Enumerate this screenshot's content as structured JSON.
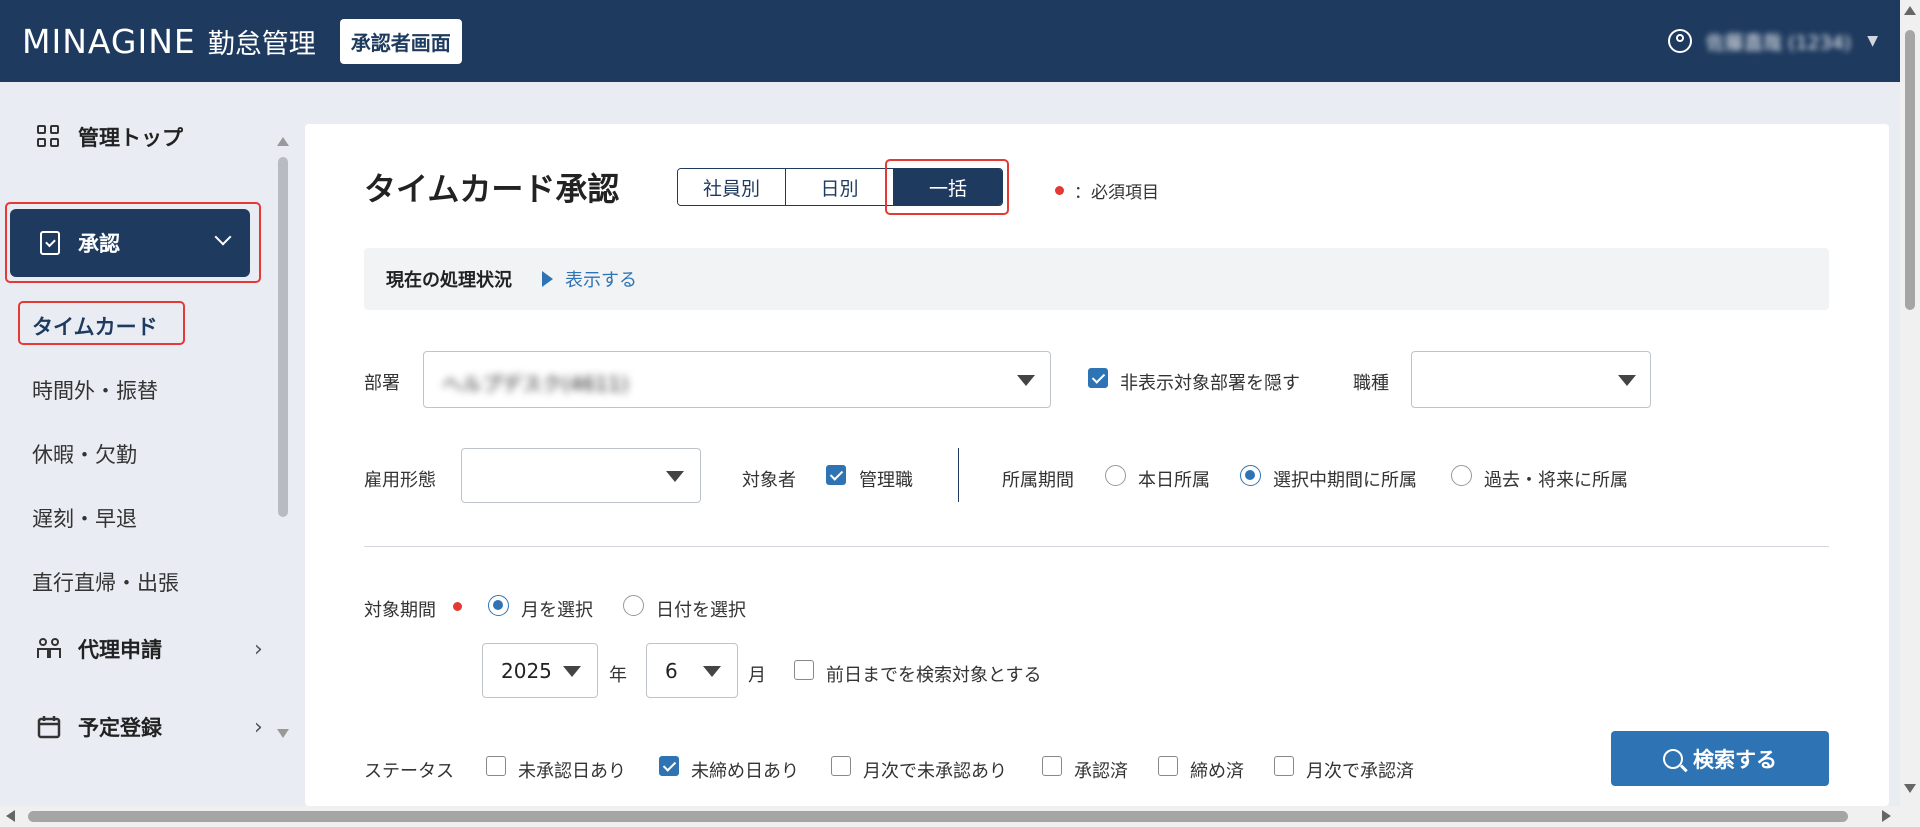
{
  "header": {
    "logo": "MINAGINE",
    "app_name": "勤怠管理",
    "role_badge": "承認者画面",
    "user_name": "佐藤直哉 (1234)"
  },
  "sidebar": {
    "items": [
      {
        "label": "管理トップ",
        "icon": "grid-icon"
      },
      {
        "label": "承認",
        "icon": "document-check-icon",
        "active": true,
        "expanded": true
      },
      {
        "label": "代理申請",
        "icon": "people-icon"
      },
      {
        "label": "予定登録",
        "icon": "calendar-icon"
      }
    ],
    "sub_items": [
      {
        "label": "タイムカード",
        "active": true
      },
      {
        "label": "時間外・振替"
      },
      {
        "label": "休暇・欠勤"
      },
      {
        "label": "遅刻・早退"
      },
      {
        "label": "直行直帰・出張"
      }
    ]
  },
  "main": {
    "title": "タイムカード承認",
    "view_tabs": [
      "社員別",
      "日別",
      "一括"
    ],
    "active_tab": "一括",
    "required_note": "：必須項目",
    "status_bar": {
      "label": "現在の処理状況",
      "toggle": "表示する"
    },
    "filters": {
      "department_label": "部署",
      "department_value": "ヘルプデスク(4611)",
      "hide_department_label": "非表示対象部署を隠す",
      "hide_department_checked": true,
      "job_label": "職種",
      "job_value": "",
      "employment_label": "雇用形態",
      "employment_value": "",
      "target_label": "対象者",
      "manager_label": "管理職",
      "manager_checked": true,
      "affiliation_label": "所属期間",
      "affiliation_options": [
        "本日所属",
        "選択中期間に所属",
        "過去・将来に所属"
      ],
      "affiliation_selected": "選択中期間に所属"
    },
    "period": {
      "label": "対象期間",
      "options": [
        "月を選択",
        "日付を選択"
      ],
      "selected": "月を選択",
      "year": "2025",
      "year_unit": "年",
      "month": "6",
      "month_unit": "月",
      "until_yesterday_label": "前日までを検索対象とする",
      "until_yesterday_checked": false
    },
    "status": {
      "label": "ステータス",
      "options": [
        {
          "label": "未承認日あり",
          "checked": false
        },
        {
          "label": "未締め日あり",
          "checked": true
        },
        {
          "label": "月次で未承認あり",
          "checked": false
        },
        {
          "label": "承認済",
          "checked": false
        },
        {
          "label": "締め済",
          "checked": false
        },
        {
          "label": "月次で承認済",
          "checked": false
        }
      ]
    },
    "search_button": "検索する"
  },
  "colors": {
    "brand": "#1e3a5f",
    "accent": "#2e74b5",
    "required": "#e53935",
    "highlight": "#e53935"
  }
}
